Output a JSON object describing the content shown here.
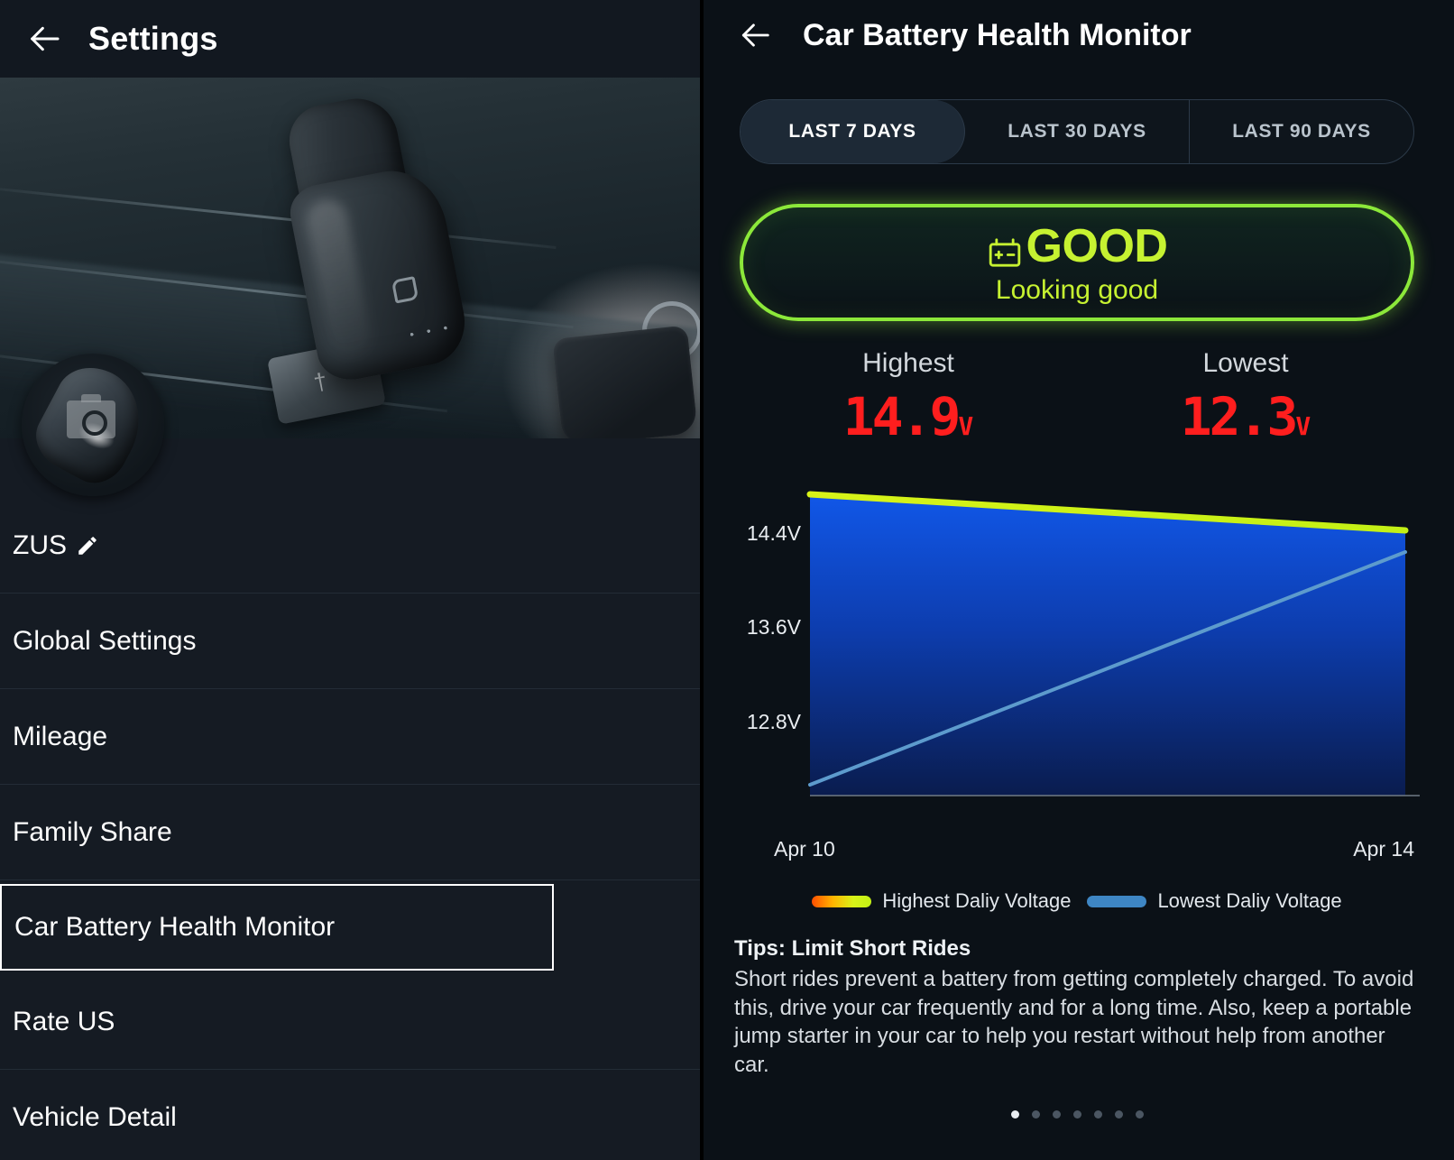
{
  "left_panel": {
    "title": "Settings",
    "back_icon": "back-arrow-icon",
    "profile_name": "ZUS",
    "edit_icon": "pencil-icon",
    "avatar_overlay_icon": "camera-icon",
    "menu_items": [
      {
        "label": "Global Settings",
        "selected": false
      },
      {
        "label": "Mileage",
        "selected": false
      },
      {
        "label": "Family Share",
        "selected": false
      },
      {
        "label": "Car Battery Health Monitor",
        "selected": true
      },
      {
        "label": "Rate US",
        "selected": false
      },
      {
        "label": "Vehicle Detail",
        "selected": false
      }
    ]
  },
  "right_panel": {
    "title": "Car Battery Health Monitor",
    "back_icon": "back-arrow-icon",
    "tabs": [
      {
        "label": "LAST 7 DAYS",
        "active": true
      },
      {
        "label": "LAST 30 DAYS",
        "active": false
      },
      {
        "label": "LAST 90 DAYS",
        "active": false
      }
    ],
    "status": {
      "icon": "battery-icon",
      "headline": "GOOD",
      "subtext": "Looking good",
      "color": "#c6f231",
      "border_color": "#8ce83a"
    },
    "stats": [
      {
        "label": "Highest",
        "value": "14.9",
        "unit": "V",
        "color": "#ff1e1e"
      },
      {
        "label": "Lowest",
        "value": "12.3",
        "unit": "V",
        "color": "#ff1e1e"
      }
    ],
    "tips": {
      "title": "Tips: Limit Short Rides",
      "body": "Short rides prevent a battery from getting completely charged. To avoid this, drive your car frequently and for a long time. Also, keep a portable jump starter in your car to help you restart without help from another car."
    },
    "pagination": {
      "count": 7,
      "active_index": 0
    }
  },
  "chart_data": {
    "type": "area",
    "title": "",
    "xlabel": "",
    "ylabel": "",
    "x": [
      "Apr 10",
      "Apr 14"
    ],
    "x_tick_labels": [
      "Apr 10",
      "Apr 14"
    ],
    "y_tick_labels": [
      "14.4V",
      "13.6V",
      "12.8V"
    ],
    "y_tick_values": [
      14.4,
      13.6,
      12.8
    ],
    "ylim": [
      12.2,
      15.1
    ],
    "grid": false,
    "legend_position": "bottom",
    "series": [
      {
        "name": "Highest Daliy Voltage",
        "color": "#c3f016",
        "gradient": [
          "#ff4e00",
          "#ffb300",
          "#c3f016"
        ],
        "values": [
          15.0,
          14.75
        ]
      },
      {
        "name": "Lowest Daliy Voltage",
        "color": "#3e86c4",
        "values": [
          12.35,
          14.35
        ]
      }
    ],
    "fill": {
      "between": [
        "Highest Daliy Voltage",
        "Lowest Daliy Voltage"
      ],
      "gradient": [
        "#1157e8",
        "#0a2a7a",
        "#0b1b4a"
      ]
    }
  }
}
